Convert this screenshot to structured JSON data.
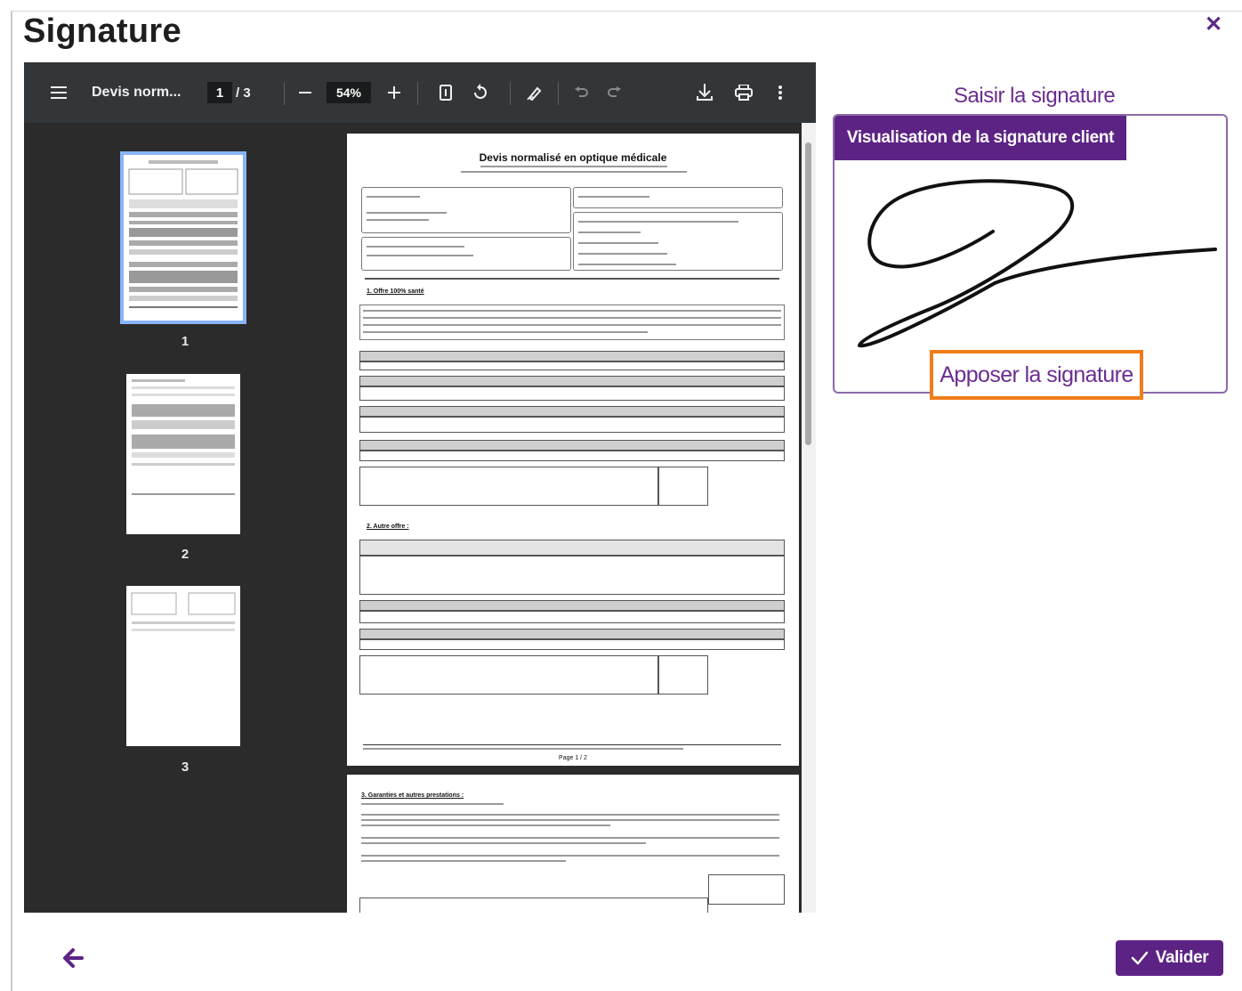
{
  "modal": {
    "title": "Signature",
    "close_icon": "close-icon"
  },
  "viewer": {
    "doc_name": "Devis norm...",
    "current_page": "1",
    "total_pages": "/ 3",
    "zoom": "54%",
    "thumbnails": [
      {
        "label": "1",
        "selected": true
      },
      {
        "label": "2",
        "selected": false
      },
      {
        "label": "3",
        "selected": false
      }
    ],
    "page": {
      "title": "Devis normalisé en optique médicale",
      "section1": "1. Offre 100% santé",
      "section2": "2. Autre offre :",
      "section3": "3. Garanties et autres prestations :",
      "footer": "Page 1 / 2"
    }
  },
  "signature": {
    "heading": "Saisir la signature",
    "tab_label": "Visualisation de la signature client",
    "apply_label": "Apposer la signature"
  },
  "footer": {
    "validate_label": "Valider"
  },
  "colors": {
    "brand_purple": "#5c2384",
    "highlight_orange": "#ef7d1b"
  }
}
